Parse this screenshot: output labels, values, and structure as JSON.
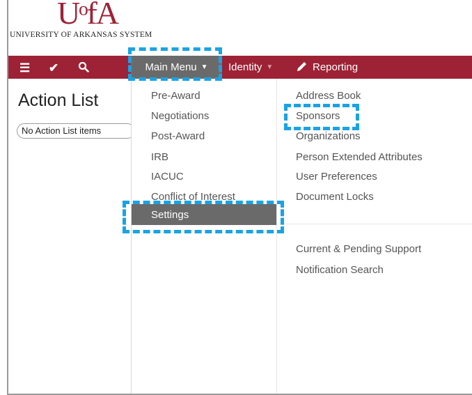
{
  "header": {
    "logo_mark": "UᵒfA",
    "logo_text": "UNIVERSITY OF ARKANSAS SYSTEM"
  },
  "navbar": {
    "main_menu_label": "Main Menu",
    "identity_label": "Identity",
    "reporting_label": "Reporting"
  },
  "action_list": {
    "title": "Action List",
    "empty_text": "No Action List items"
  },
  "dropdown": {
    "col1": [
      "Pre-Award",
      "Negotiations",
      "Post-Award",
      "IRB",
      "IACUC",
      "Conflict of Interest"
    ],
    "settings_label": "Settings",
    "col2": [
      "Address Book",
      "Sponsors",
      "Organizations",
      "Person Extended Attributes",
      "User Preferences",
      "Document Locks"
    ],
    "col2_lower": [
      "Current & Pending Support",
      "Notification Search"
    ]
  },
  "colors": {
    "navbar": "#9d2235",
    "active_menu": "#6a6a6a",
    "highlight": "#1aa3e3"
  }
}
